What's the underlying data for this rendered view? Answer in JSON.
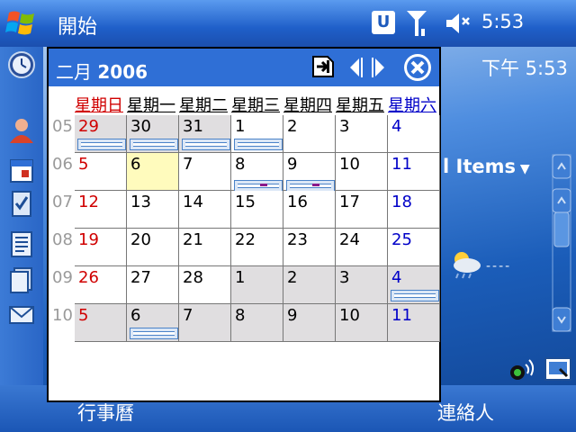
{
  "titlebar": {
    "app_title": "開始",
    "clock": "5:53",
    "u_label": "U"
  },
  "today": {
    "time_label": "下午 5:53",
    "items_label": "l Items",
    "weather_temp": "----"
  },
  "softkeys": {
    "left": "行事曆",
    "right": "連絡人"
  },
  "calendar": {
    "month": "二月",
    "year": "2006",
    "weekdays": [
      "星期日",
      "星期一",
      "星期二",
      "星期三",
      "星期四",
      "星期五",
      "星期六"
    ],
    "weeks": [
      {
        "week": "05",
        "days": [
          "29",
          "30",
          "31",
          "1",
          "2",
          "3",
          "4"
        ]
      },
      {
        "week": "06",
        "days": [
          "5",
          "6",
          "7",
          "8",
          "9",
          "10",
          "11"
        ]
      },
      {
        "week": "07",
        "days": [
          "12",
          "13",
          "14",
          "15",
          "16",
          "17",
          "18"
        ]
      },
      {
        "week": "08",
        "days": [
          "19",
          "20",
          "21",
          "22",
          "23",
          "24",
          "25"
        ]
      },
      {
        "week": "09",
        "days": [
          "26",
          "27",
          "28",
          "1",
          "2",
          "3",
          "4"
        ]
      },
      {
        "week": "10",
        "days": [
          "5",
          "6",
          "7",
          "8",
          "9",
          "10",
          "11"
        ]
      }
    ],
    "today_label": "6"
  },
  "colors": {
    "sunday": "#d00000",
    "saturday": "#0000c8",
    "header": "#2f6fd6",
    "today_bg": "#fffbbd"
  }
}
